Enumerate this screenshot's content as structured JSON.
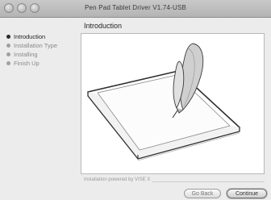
{
  "window": {
    "title": "Pen Pad Tablet Driver V1.74-USB"
  },
  "sidebar": {
    "steps": [
      {
        "label": "Introduction",
        "state": "active"
      },
      {
        "label": "Installation Type",
        "state": "pending"
      },
      {
        "label": "Installing",
        "state": "pending"
      },
      {
        "label": "Finish Up",
        "state": "pending"
      }
    ]
  },
  "main": {
    "heading": "Introduction",
    "illustration": "pen-tablet-illustration"
  },
  "footer": {
    "powered_by": "Installation powered by VISE X",
    "back_label": "Go Back",
    "continue_label": "Continue"
  }
}
